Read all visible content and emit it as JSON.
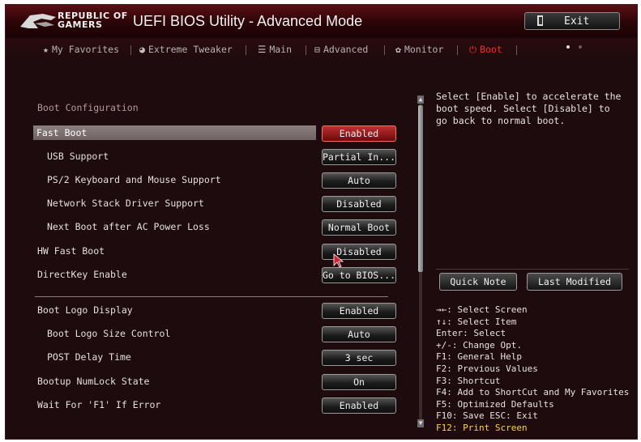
{
  "header": {
    "brand_line1": "REPUBLIC OF",
    "brand_line2": "GAMERS",
    "title": "UEFI BIOS Utility - Advanced Mode",
    "exit_label": "Exit"
  },
  "tabs": [
    {
      "label": "My Favorites",
      "icon": "star-icon",
      "active": false
    },
    {
      "label": "Extreme Tweaker",
      "icon": "tweaker-icon",
      "active": false
    },
    {
      "label": "Main",
      "icon": "list-icon",
      "active": false
    },
    {
      "label": "Advanced",
      "icon": "advanced-icon",
      "active": false
    },
    {
      "label": "Monitor",
      "icon": "monitor-icon",
      "active": false
    },
    {
      "label": "Boot",
      "icon": "power-icon",
      "active": true
    }
  ],
  "boot": {
    "section_title": "Boot Configuration",
    "items": [
      {
        "label": "Fast Boot",
        "value": "Enabled",
        "indent": false,
        "selected": true
      },
      {
        "label": "USB Support",
        "value": "Partial In...",
        "indent": true,
        "selected": false
      },
      {
        "label": "PS/2 Keyboard and Mouse Support",
        "value": "Auto",
        "indent": true,
        "selected": false
      },
      {
        "label": "Network Stack Driver Support",
        "value": "Disabled",
        "indent": true,
        "selected": false
      },
      {
        "label": "Next Boot after AC Power Loss",
        "value": "Normal Boot",
        "indent": true,
        "selected": false
      },
      {
        "label": "HW Fast Boot",
        "value": "Disabled",
        "indent": false,
        "selected": false
      },
      {
        "label": "DirectKey Enable",
        "value": "Go to BIOS...",
        "indent": false,
        "selected": false
      }
    ],
    "items2": [
      {
        "label": "Boot Logo Display",
        "value": "Enabled",
        "indent": false
      },
      {
        "label": "Boot Logo Size Control",
        "value": "Auto",
        "indent": true
      },
      {
        "label": "POST Delay Time",
        "value": "3 sec",
        "indent": true
      },
      {
        "label": "Bootup NumLock State",
        "value": "On",
        "indent": false
      },
      {
        "label": "Wait For 'F1' If Error",
        "value": "Enabled",
        "indent": false
      }
    ]
  },
  "help": {
    "text": "Select [Enable] to accelerate the boot speed. Select [Disable] to go back to normal boot.",
    "quick_note": "Quick Note",
    "last_modified": "Last Modified",
    "keys": [
      "→←: Select Screen",
      "↑↓: Select Item",
      "Enter: Select",
      "+/-: Change Opt.",
      "F1: General Help",
      "F2: Previous Values",
      "F3: Shortcut",
      "F4: Add to ShortCut and My Favorites",
      "F5: Optimized Defaults",
      "F10: Save  ESC: Exit"
    ],
    "key_highlight": "F12: Print Screen"
  },
  "colors": {
    "active_tab": "#ff2a2a",
    "highlight_key": "#ffd24a",
    "background": "#1d0b0d"
  }
}
